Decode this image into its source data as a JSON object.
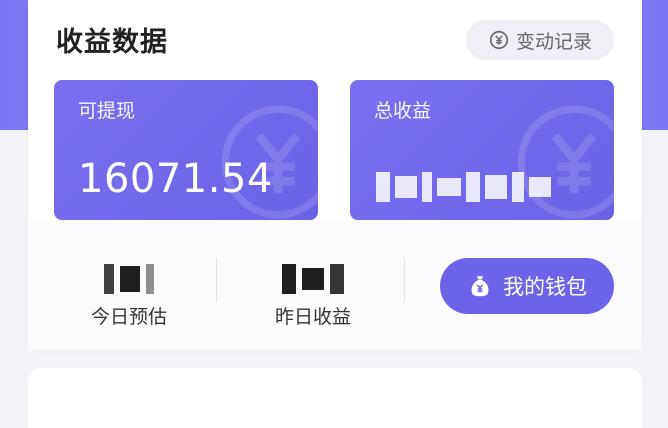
{
  "header": {
    "title": "收益数据"
  },
  "history_button": {
    "label": "变动记录",
    "icon": "yuan-cycle-icon"
  },
  "withdrawable": {
    "label": "可提现",
    "value": "16071.54"
  },
  "total_income": {
    "label": "总收益",
    "value_obscured": true
  },
  "today": {
    "label": "今日预估"
  },
  "yesterday": {
    "label": "昨日收益"
  },
  "wallet_button": {
    "label": "我的钱包",
    "icon": "money-bag-icon"
  },
  "colors": {
    "accent": "#6d63e8",
    "card": "#7a6ff0",
    "band": "#8d86f4"
  }
}
